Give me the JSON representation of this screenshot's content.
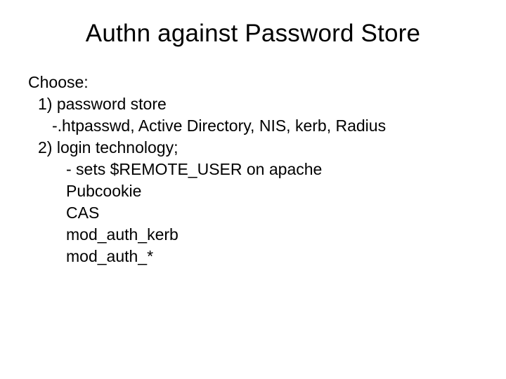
{
  "title": "Authn against Password Store",
  "lines": [
    {
      "text": "Choose:",
      "indent": 0
    },
    {
      "text": "1) password store",
      "indent": 1
    },
    {
      "text": "-.htpasswd, Active Directory, NIS, kerb, Radius",
      "indent": 2
    },
    {
      "text": "2) login technology;",
      "indent": 1
    },
    {
      "text": "- sets $REMOTE_USER  on apache",
      "indent": 3
    },
    {
      "text": "Pubcookie",
      "indent": 3
    },
    {
      "text": "CAS",
      "indent": 3
    },
    {
      "text": "mod_auth_kerb",
      "indent": 3
    },
    {
      "text": "mod_auth_*",
      "indent": 3
    }
  ]
}
